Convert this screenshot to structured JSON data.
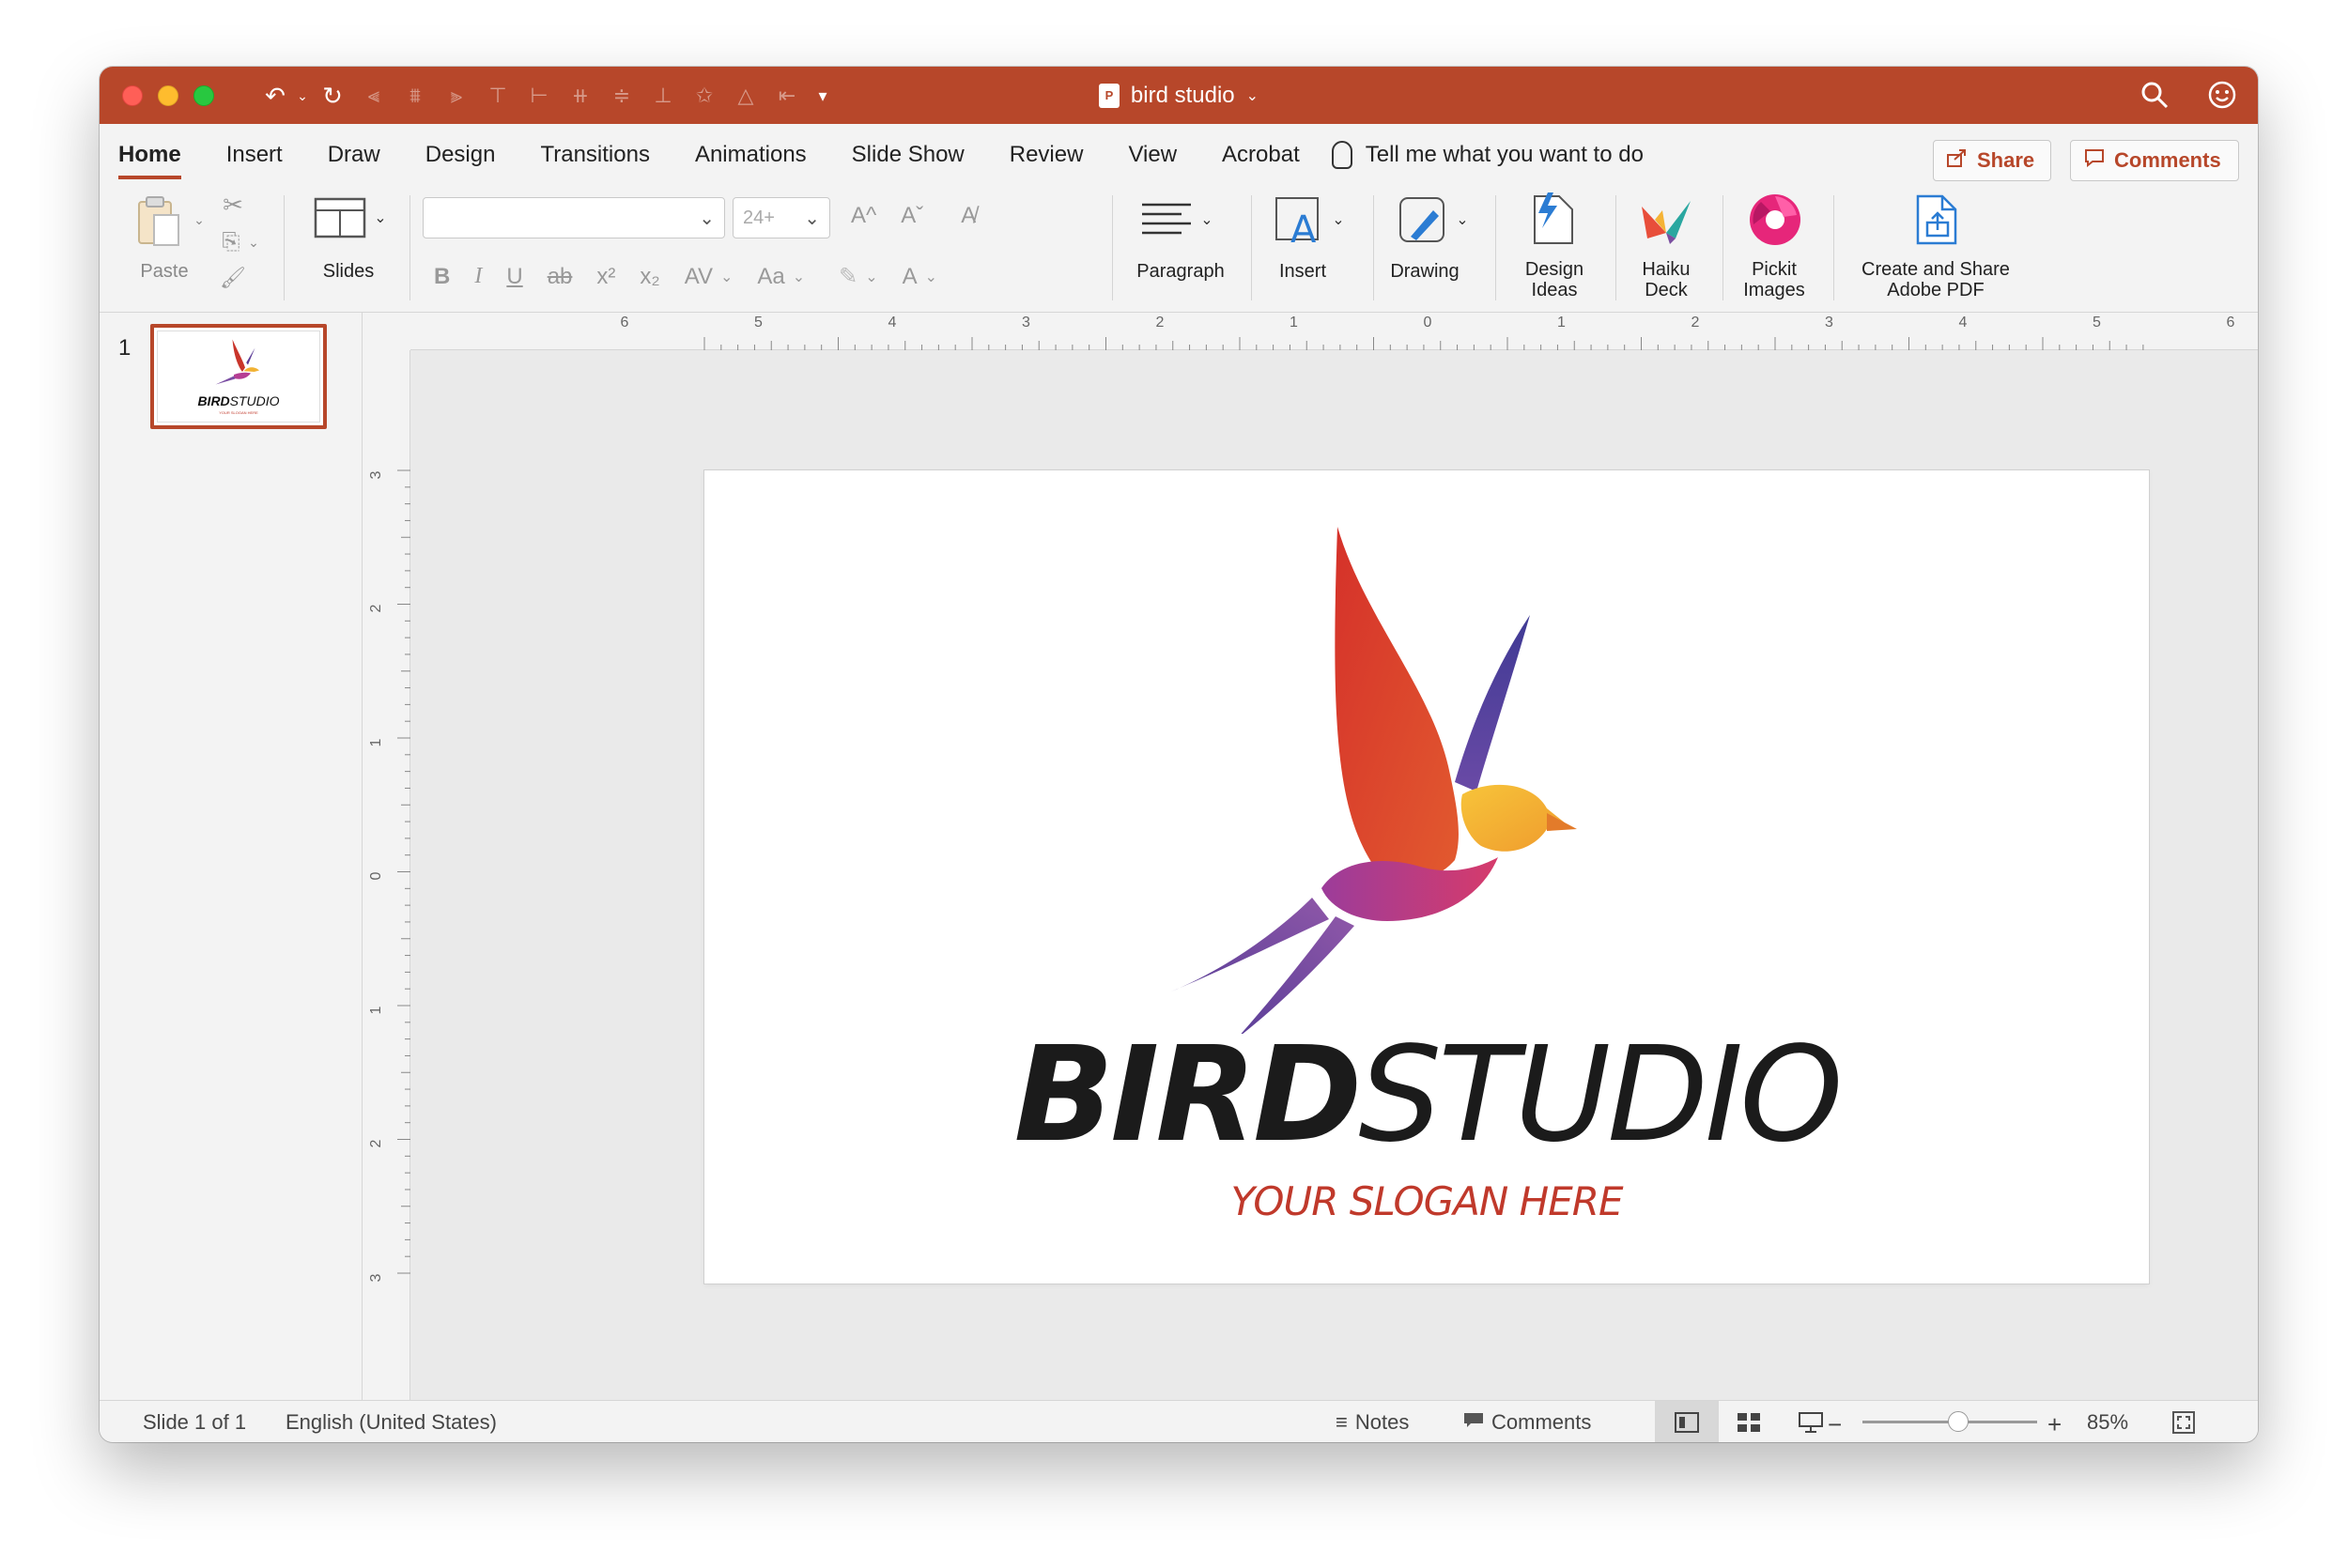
{
  "titlebar": {
    "doc_title": "bird studio",
    "doc_icon_label": "P",
    "colors": {
      "accent": "#b7472a",
      "close": "#ff5f57",
      "minimize": "#febc2e",
      "zoom": "#28c840"
    }
  },
  "tabs": [
    {
      "label": "Home",
      "active": true
    },
    {
      "label": "Insert"
    },
    {
      "label": "Draw"
    },
    {
      "label": "Design"
    },
    {
      "label": "Transitions"
    },
    {
      "label": "Animations"
    },
    {
      "label": "Slide Show"
    },
    {
      "label": "Review"
    },
    {
      "label": "View"
    },
    {
      "label": "Acrobat"
    }
  ],
  "tellme": "Tell me what you want to do",
  "actions": {
    "share": "Share",
    "comments": "Comments"
  },
  "ribbon": {
    "paste": "Paste",
    "slides": "Slides",
    "font_size": "24+",
    "paragraph": "Paragraph",
    "insert": "Insert",
    "drawing": "Drawing",
    "design_ideas_1": "Design",
    "design_ideas_2": "Ideas",
    "haiku_1": "Haiku",
    "haiku_2": "Deck",
    "pickit_1": "Pickit",
    "pickit_2": "Images",
    "adobe_1": "Create and Share",
    "adobe_2": "Adobe PDF",
    "fmt": {
      "bold": "B",
      "italic": "I",
      "underline": "U",
      "strike": "ab",
      "superscript": "x²",
      "subscript": "x₂",
      "spacing": "AV",
      "case": "Aa",
      "grow": "A^",
      "shrink": "Aˇ",
      "color": "A"
    }
  },
  "thumbnails": {
    "number": "1",
    "bold": "BIRD",
    "light": "STUDIO",
    "slogan": "YOUR SLOGAN HERE"
  },
  "ruler": {
    "h_labels": [
      "6",
      "5",
      "4",
      "3",
      "2",
      "1",
      "0",
      "1",
      "2",
      "3",
      "4",
      "5",
      "6"
    ],
    "v_labels": [
      "3",
      "2",
      "1",
      "0",
      "1",
      "2",
      "3"
    ]
  },
  "slide": {
    "brand_bold": "BIRD",
    "brand_light": "STUDIO",
    "slogan": "YOUR SLOGAN HERE"
  },
  "status": {
    "slide_count": "Slide 1 of 1",
    "language": "English (United States)",
    "notes": "Notes",
    "comments": "Comments",
    "zoom": "85%",
    "zoom_minus": "−",
    "zoom_plus": "+",
    "zoom_level": 0.55
  }
}
